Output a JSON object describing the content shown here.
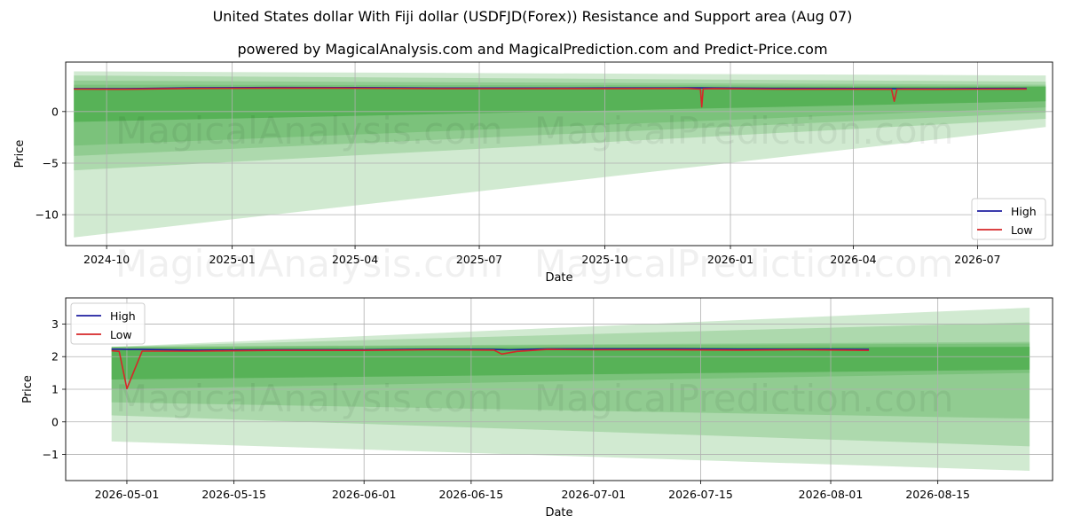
{
  "title": "United States dollar With Fiji dollar (USDFJD(Forex)) Resistance and Support area (Aug 07)",
  "subtitle": "powered by MagicalAnalysis.com and MagicalPrediction.com and Predict-Price.com",
  "watermarks": [
    "MagicalAnalysis.com",
    "MagicalPrediction.com"
  ],
  "colors": {
    "high": "#1f1fa0",
    "low": "#d62728",
    "band": "#2ca02c"
  },
  "chart_data": [
    {
      "type": "line",
      "xlabel": "Date",
      "ylabel": "Price",
      "xlim": [
        "2024-09-01",
        "2026-08-25"
      ],
      "ylim": [
        -13,
        4.8
      ],
      "xticks": [
        "2024-10",
        "2025-01",
        "2025-04",
        "2025-07",
        "2025-10",
        "2026-01",
        "2026-04",
        "2026-07"
      ],
      "xtick_labels": [
        "2024-10",
        "2025-01",
        "2025-04",
        "2025-07",
        "2025-10",
        "2026-01",
        "2026-04",
        "2026-07"
      ],
      "yticks": [
        -10,
        -5,
        0
      ],
      "ytick_labels": [
        "−10",
        "−5",
        "0"
      ],
      "grid": true,
      "legend": {
        "position": "bottom-right",
        "entries": [
          "High",
          "Low"
        ]
      },
      "bands": {
        "x_start": "2024-09-07",
        "x_end": "2026-08-20",
        "fill_opacity": [
          0.22,
          0.22,
          0.22,
          0.22,
          0.45
        ],
        "start": [
          [
            -12.2,
            3.9
          ],
          [
            -5.7,
            3.5
          ],
          [
            -4.3,
            3.0
          ],
          [
            -3.3,
            2.6
          ],
          [
            -1.0,
            2.3
          ]
        ],
        "end": [
          [
            -1.5,
            3.5
          ],
          [
            -0.7,
            2.9
          ],
          [
            -0.1,
            2.6
          ],
          [
            0.4,
            2.5
          ],
          [
            1.0,
            2.4
          ]
        ]
      },
      "series": [
        {
          "name": "High",
          "x": [
            "2024-09-07",
            "2024-10-15",
            "2024-12-01",
            "2025-02-01",
            "2025-04-01",
            "2025-06-01",
            "2025-08-01",
            "2025-10-01",
            "2025-12-01",
            "2025-12-10",
            "2025-12-11",
            "2025-12-12",
            "2025-12-20",
            "2026-02-01",
            "2026-04-01",
            "2026-04-29",
            "2026-05-01",
            "2026-05-03",
            "2026-06-01",
            "2026-07-01",
            "2026-08-06"
          ],
          "y": [
            2.22,
            2.22,
            2.3,
            2.33,
            2.32,
            2.28,
            2.28,
            2.29,
            2.3,
            2.3,
            2.3,
            2.3,
            2.29,
            2.25,
            2.24,
            2.23,
            2.23,
            2.23,
            2.22,
            2.24,
            2.25
          ]
        },
        {
          "name": "Low",
          "x": [
            "2024-09-07",
            "2024-10-15",
            "2024-12-01",
            "2025-02-01",
            "2025-04-01",
            "2025-06-01",
            "2025-08-01",
            "2025-10-01",
            "2025-12-01",
            "2025-12-10",
            "2025-12-11",
            "2025-12-12",
            "2025-12-20",
            "2026-02-01",
            "2026-04-01",
            "2026-04-29",
            "2026-05-01",
            "2026-05-03",
            "2026-06-01",
            "2026-07-01",
            "2026-08-06"
          ],
          "y": [
            2.18,
            2.16,
            2.24,
            2.27,
            2.26,
            2.22,
            2.22,
            2.23,
            2.24,
            2.18,
            0.45,
            2.2,
            2.23,
            2.18,
            2.17,
            2.16,
            1.0,
            2.17,
            2.16,
            2.18,
            2.19
          ]
        }
      ]
    },
    {
      "type": "line",
      "xlabel": "Date",
      "ylabel": "Price",
      "xlim": [
        "2026-04-23",
        "2026-08-30"
      ],
      "ylim": [
        -1.8,
        3.8
      ],
      "xticks": [
        "2026-05-01",
        "2026-05-15",
        "2026-06-01",
        "2026-06-15",
        "2026-07-01",
        "2026-07-15",
        "2026-08-01",
        "2026-08-15"
      ],
      "xtick_labels": [
        "2026-05-01",
        "2026-05-15",
        "2026-06-01",
        "2026-06-15",
        "2026-07-01",
        "2026-07-15",
        "2026-08-01",
        "2026-08-15"
      ],
      "yticks": [
        -1,
        0,
        1,
        2,
        3
      ],
      "ytick_labels": [
        "−1",
        "0",
        "1",
        "2",
        "3"
      ],
      "grid": true,
      "legend": {
        "position": "top-left",
        "entries": [
          "High",
          "Low"
        ]
      },
      "bands": {
        "x_start": "2026-04-29",
        "x_end": "2026-08-27",
        "fill_opacity": [
          0.22,
          0.22,
          0.22,
          0.22,
          0.45
        ],
        "start": [
          [
            -0.6,
            2.3
          ],
          [
            0.2,
            2.3
          ],
          [
            0.6,
            2.3
          ],
          [
            1.0,
            2.3
          ],
          [
            1.3,
            2.25
          ]
        ],
        "end": [
          [
            -1.5,
            3.5
          ],
          [
            -0.75,
            3.05
          ],
          [
            0.1,
            2.45
          ],
          [
            1.5,
            2.4
          ],
          [
            1.6,
            2.3
          ]
        ]
      },
      "series": [
        {
          "name": "High",
          "x": [
            "2026-04-29",
            "2026-04-30",
            "2026-05-01",
            "2026-05-03",
            "2026-05-10",
            "2026-05-20",
            "2026-06-01",
            "2026-06-10",
            "2026-06-18",
            "2026-06-20",
            "2026-06-25",
            "2026-07-01",
            "2026-07-10",
            "2026-07-20",
            "2026-07-28",
            "2026-08-06"
          ],
          "y": [
            2.23,
            2.23,
            2.22,
            2.22,
            2.2,
            2.21,
            2.21,
            2.23,
            2.22,
            2.21,
            2.24,
            2.24,
            2.24,
            2.23,
            2.23,
            2.22
          ]
        },
        {
          "name": "Low",
          "x": [
            "2026-04-29",
            "2026-04-30",
            "2026-05-01",
            "2026-05-02",
            "2026-05-03",
            "2026-05-10",
            "2026-05-20",
            "2026-06-01",
            "2026-06-10",
            "2026-06-18",
            "2026-06-19",
            "2026-06-21",
            "2026-06-25",
            "2026-07-01",
            "2026-07-10",
            "2026-07-20",
            "2026-07-28",
            "2026-08-06"
          ],
          "y": [
            2.18,
            2.16,
            1.02,
            1.6,
            2.17,
            2.17,
            2.19,
            2.19,
            2.21,
            2.2,
            2.08,
            2.16,
            2.22,
            2.21,
            2.21,
            2.2,
            2.21,
            2.19
          ]
        }
      ]
    }
  ]
}
